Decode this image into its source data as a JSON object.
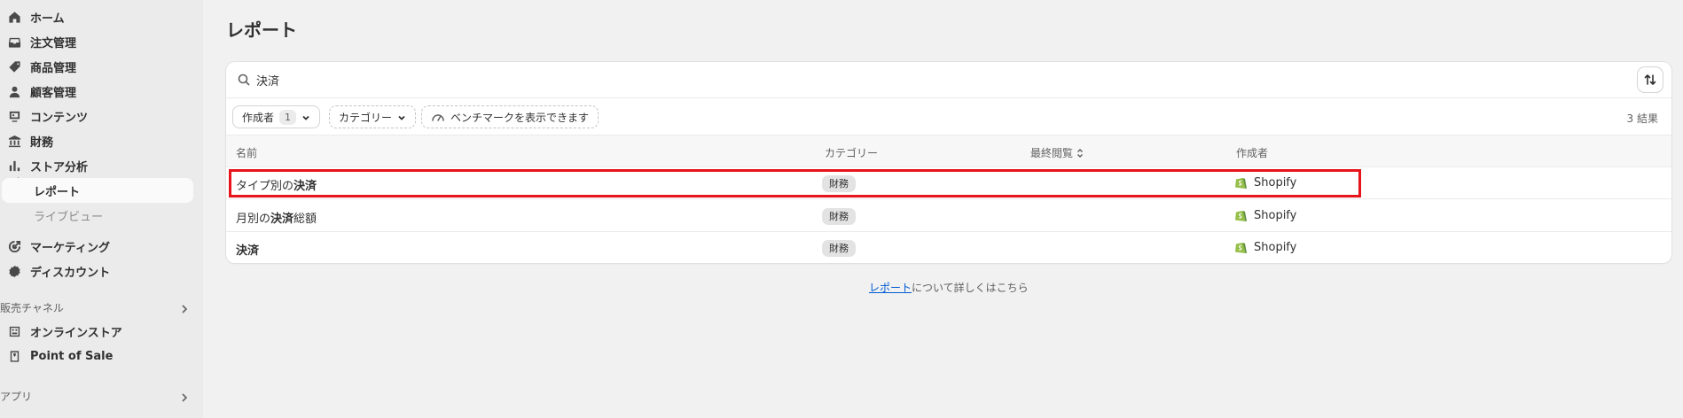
{
  "sidebar": {
    "items": [
      {
        "label": "ホーム",
        "icon": "home-icon"
      },
      {
        "label": "注文管理",
        "icon": "inbox-icon"
      },
      {
        "label": "商品管理",
        "icon": "tag-icon"
      },
      {
        "label": "顧客管理",
        "icon": "person-icon"
      },
      {
        "label": "コンテンツ",
        "icon": "content-icon"
      },
      {
        "label": "財務",
        "icon": "bank-icon"
      },
      {
        "label": "ストア分析",
        "icon": "chart-icon"
      }
    ],
    "sub_items": [
      {
        "label": "レポート",
        "active": true
      },
      {
        "label": "ライブビュー",
        "active": false
      }
    ],
    "items2": [
      {
        "label": "マーケティング",
        "icon": "target-icon"
      },
      {
        "label": "ディスカウント",
        "icon": "discount-icon"
      }
    ],
    "sales_channels": {
      "label": "販売チャネル",
      "items": [
        {
          "label": "オンラインストア",
          "icon": "store-icon"
        },
        {
          "label": "Point of Sale",
          "icon": "pos-icon"
        }
      ]
    },
    "apps": {
      "label": "アプリ"
    }
  },
  "page": {
    "title": "レポート"
  },
  "search": {
    "value": "決済",
    "placeholder": ""
  },
  "filters": {
    "author": {
      "label": "作成者",
      "count": "1"
    },
    "category": {
      "label": "カテゴリー"
    },
    "benchmark": {
      "label": "ベンチマークを表示できます"
    },
    "result_count": "3 結果"
  },
  "table": {
    "headers": {
      "name": "名前",
      "category": "カテゴリー",
      "last_viewed": "最終閲覧",
      "author": "作成者"
    },
    "rows": [
      {
        "name_pre": "タイプ別の",
        "name_bold": "決済",
        "name_post": "",
        "category": "財務",
        "author": "Shopify"
      },
      {
        "name_pre": "月別の",
        "name_bold": "決済",
        "name_post": "総額",
        "category": "財務",
        "author": "Shopify"
      },
      {
        "name_pre": "",
        "name_bold": "決済",
        "name_post": "",
        "category": "財務",
        "author": "Shopify"
      }
    ]
  },
  "footer": {
    "link": "レポート",
    "text": "について詳しくはこちら"
  },
  "colors": {
    "highlight": "#e8141c",
    "shopify_green": "#95bf47",
    "link": "#005bd3"
  }
}
